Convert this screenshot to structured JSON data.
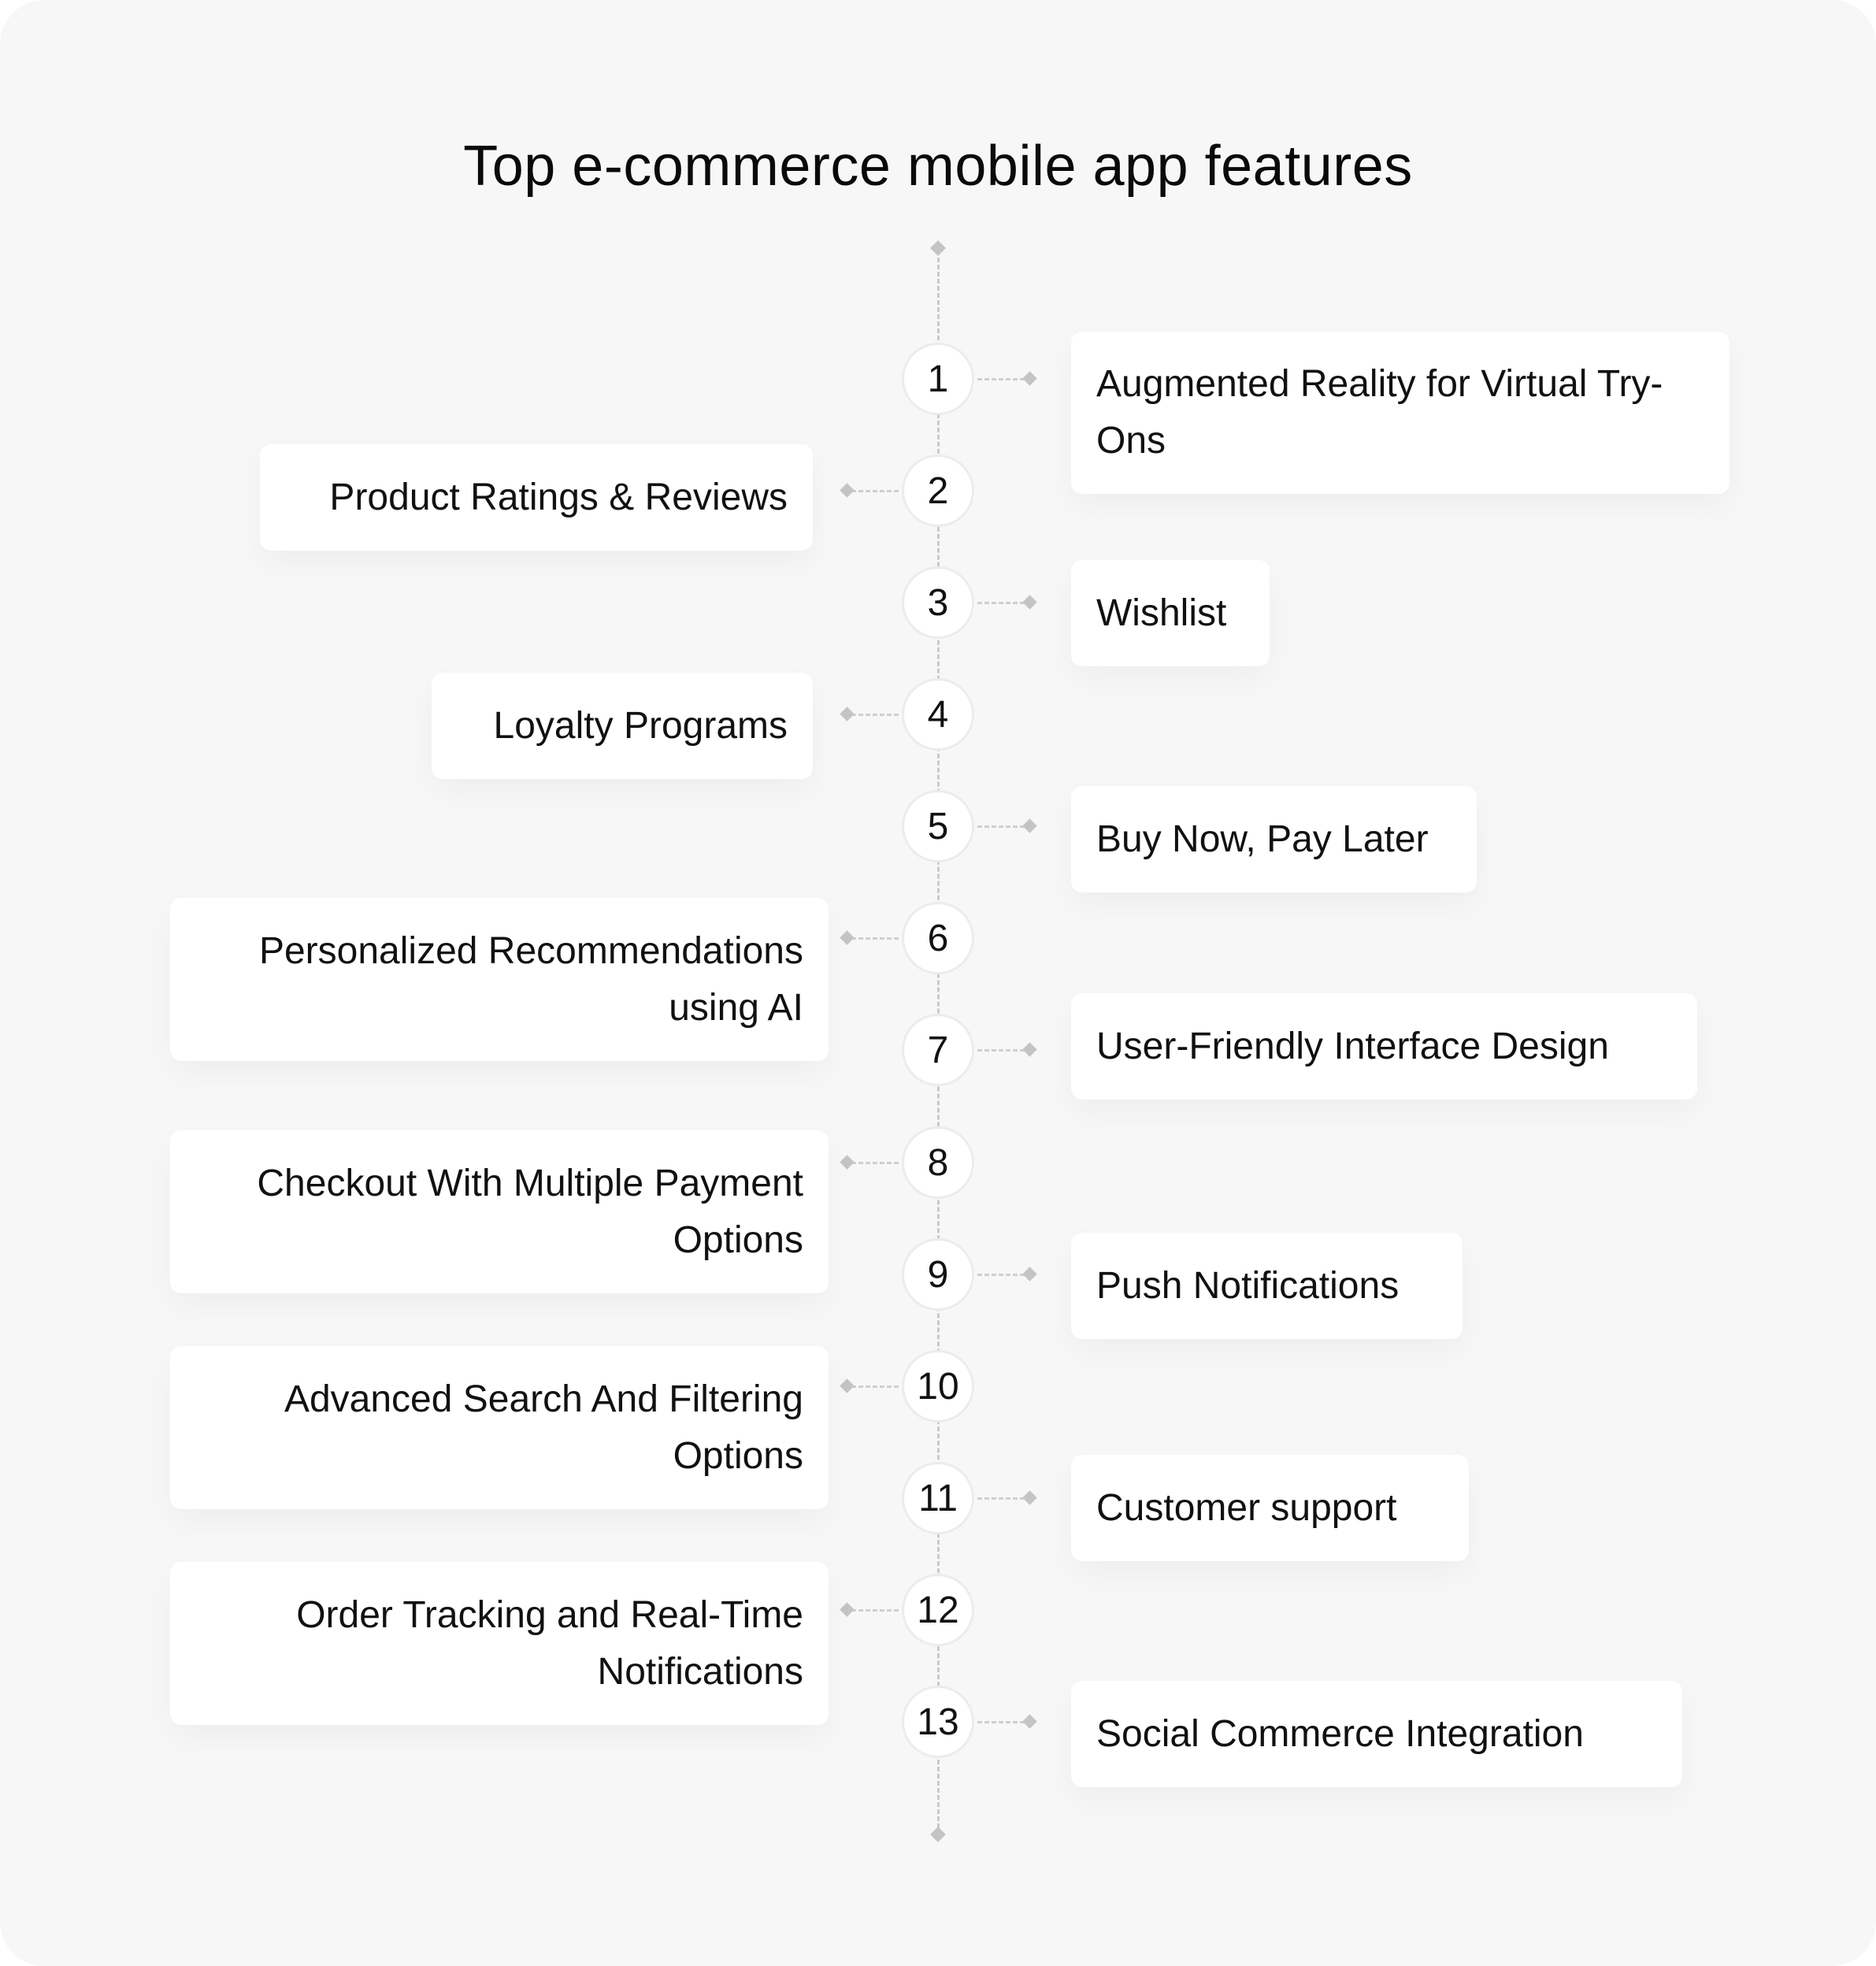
{
  "title": "Top e-commerce mobile app features",
  "colors": {
    "background": "#f7f7f7",
    "card": "#ffffff",
    "text": "#111111",
    "connector": "#c9c9c9"
  },
  "features": [
    {
      "number": "1",
      "side": "right",
      "label": "Augmented Reality for Virtual Try-Ons"
    },
    {
      "number": "2",
      "side": "left",
      "label": "Product Ratings & Reviews"
    },
    {
      "number": "3",
      "side": "right",
      "label": "Wishlist"
    },
    {
      "number": "4",
      "side": "left",
      "label": "Loyalty Programs"
    },
    {
      "number": "5",
      "side": "right",
      "label": "Buy Now, Pay Later"
    },
    {
      "number": "6",
      "side": "left",
      "label": "Personalized Recommendations using AI"
    },
    {
      "number": "7",
      "side": "right",
      "label": "User-Friendly Interface Design"
    },
    {
      "number": "8",
      "side": "left",
      "label": "Checkout With Multiple Payment Options"
    },
    {
      "number": "9",
      "side": "right",
      "label": "Push Notifications"
    },
    {
      "number": "10",
      "side": "left",
      "label": "Advanced Search And Filtering Options"
    },
    {
      "number": "11",
      "side": "right",
      "label": "Customer support"
    },
    {
      "number": "12",
      "side": "left",
      "label": "Order Tracking and Real-Time Notifications"
    },
    {
      "number": "13",
      "side": "right",
      "label": "Social Commerce Integration"
    }
  ]
}
